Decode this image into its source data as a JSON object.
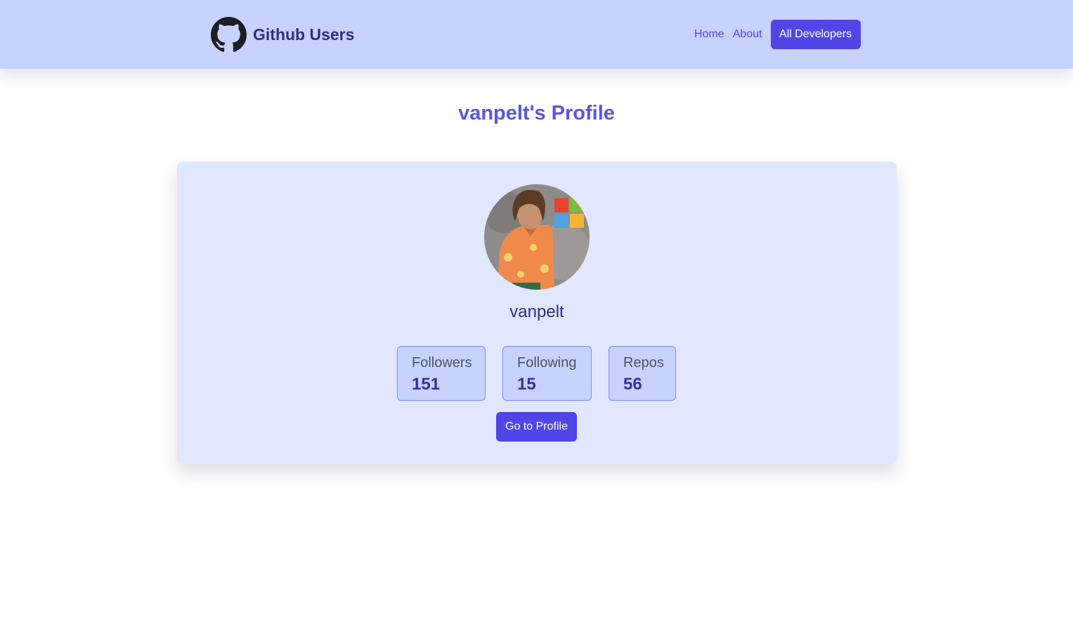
{
  "header": {
    "brand_name": "Github Users",
    "brand_icon": "github-octocat-icon",
    "nav": {
      "home": "Home",
      "about": "About",
      "all_developers": "All Developers"
    }
  },
  "page": {
    "title": "vanpelt's Profile"
  },
  "profile": {
    "username": "vanpelt",
    "avatar_alt": "vanpelt avatar",
    "stats": [
      {
        "label": "Followers",
        "value": "151"
      },
      {
        "label": "Following",
        "value": "15"
      },
      {
        "label": "Repos",
        "value": "56"
      }
    ],
    "profile_button": "Go to Profile"
  },
  "colors": {
    "navbar_bg": "#c7d2fe",
    "card_bg": "#e0e7ff",
    "accent": "#4f46e5",
    "title_text": "#312e81"
  }
}
